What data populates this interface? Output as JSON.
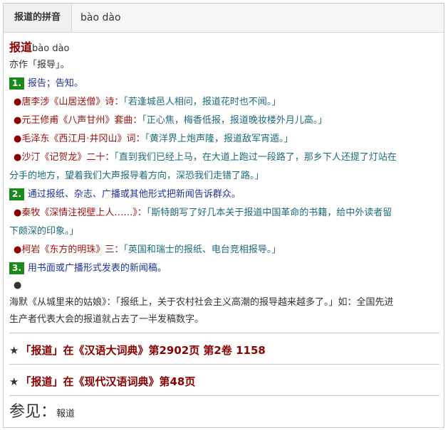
{
  "header": {
    "tab_label": "报道的拼音",
    "tab_value": "bào dào"
  },
  "entry": {
    "word": "报道",
    "pinyin": "bào dào",
    "also": "亦作「报导」。",
    "senses": [
      {
        "num": "1.",
        "definition": "报告；告知。",
        "examples": [
          {
            "source": "唐李涉《山居送僧》诗：",
            "quote": "「若逢城邑人相问，报道花时也不闻。」"
          },
          {
            "source": "元王修甫《八声甘州》套曲：",
            "quote": "「正心焦，梅香低报，报道晚妆楼外月儿高。」"
          },
          {
            "source": "毛泽东《西江月·井冈山》词：",
            "quote": "「黄洋界上炮声隆，报道敌军宵遁。」"
          },
          {
            "source": "沙汀《记贺龙》二十：",
            "quote_a": "「直到我们已经上马，在大道上跑过一段路了，那乡下人还提了灯站在",
            "quote_b": "分手的地方，望着我们大声报导着方向，深恐我们走错了路。」"
          }
        ]
      },
      {
        "num": "2.",
        "definition": "通过报纸、杂志、广播或其他形式把新闻告诉群众。",
        "examples": [
          {
            "source": "秦牧《深情注视壁上人……》：",
            "quote_a": "「斯特朗写了好几本关于报道中国革命的书籍，给中外读者留",
            "quote_b": "下颇深的印象。」"
          },
          {
            "source": "柯岩《东方的明珠》三：",
            "quote": "「英国和瑞士的报纸、电台竞相报导。」"
          }
        ]
      },
      {
        "num": "3.",
        "definition": "用书面或广播形式发表的新闻稿。",
        "plain_a": "海默《从城里来的姑娘》：「报纸上，关于农村社会主义高潮的报导越来越多了。」如：全国先进",
        "plain_b": "生产者代表大会的报道就占去了一半发稿数字。"
      }
    ]
  },
  "references": [
    {
      "star": "★",
      "text": "「报道」在《汉语大词典》第2902页 第2卷 1158"
    },
    {
      "star": "★",
      "text": "「报道」在《现代汉语词典》第48页"
    }
  ],
  "see_also": {
    "label": "参见：",
    "word": "報道"
  },
  "colors": {
    "head_word": "#8b0000",
    "number_badge": "#1a8a1a",
    "definition": "#2030a0",
    "source": "#9b1010",
    "quote": "#1d6b79"
  }
}
